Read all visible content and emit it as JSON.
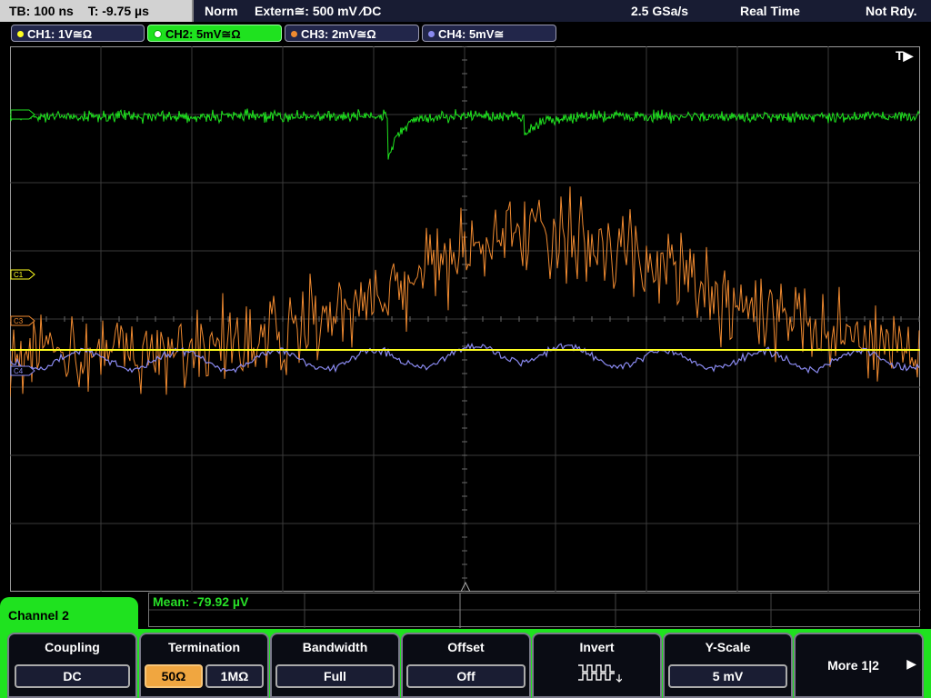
{
  "status_bar": {
    "timebase": "TB: 100 ns",
    "trigger_time": "T: -9.75 µs",
    "trigger_mode": "Norm",
    "trigger_source": "Extern≅: 500 mV ∕DC",
    "sample_rate": "2.5 GSa/s",
    "acq_mode": "Real Time",
    "state": "Not Rdy."
  },
  "channels": [
    {
      "label": "CH1: 1V≅Ω",
      "color": "#ffff20"
    },
    {
      "label": "CH2: 5mV≅Ω",
      "color": "#1fe21f",
      "active": true
    },
    {
      "label": "CH3: 2mV≅Ω",
      "color": "#f08a30"
    },
    {
      "label": "CH4: 5mV≅",
      "color": "#8a8af0"
    }
  ],
  "markers": {
    "trigger": "T▶",
    "c1": "C1",
    "c3": "C3",
    "c4": "C4"
  },
  "measurement": {
    "text": "Mean: -79.92 µV"
  },
  "menu": {
    "channel_tab": "Channel 2",
    "coupling": {
      "title": "Coupling",
      "value": "DC"
    },
    "termination": {
      "title": "Termination",
      "opt1": "50Ω",
      "opt2": "1MΩ"
    },
    "bandwidth": {
      "title": "Bandwidth",
      "value": "Full"
    },
    "offset": {
      "title": "Offset",
      "value": "Off"
    },
    "invert": {
      "title": "Invert"
    },
    "yscale": {
      "title": "Y-Scale",
      "value": "5 mV"
    },
    "more": {
      "label": "More 1|2"
    }
  }
}
